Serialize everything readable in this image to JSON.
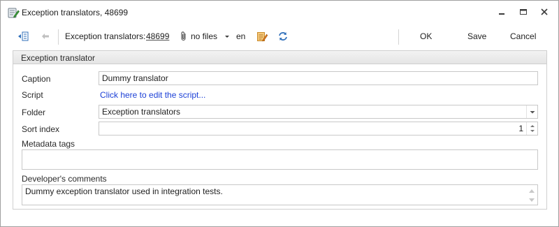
{
  "window": {
    "title": "Exception translators, 48699",
    "icon": "script-edit-icon"
  },
  "toolbar": {
    "entity_label": "Exception translators:",
    "entity_id": "48699",
    "files_label": "no files",
    "language": "en",
    "ok_label": "OK",
    "save_label": "Save",
    "cancel_label": "Cancel"
  },
  "group": {
    "title": "Exception translator"
  },
  "form": {
    "caption_label": "Caption",
    "caption_value": "Dummy translator",
    "script_label": "Script",
    "script_link": "Click here to edit the script...",
    "folder_label": "Folder",
    "folder_value": "Exception translators",
    "sort_label": "Sort index",
    "sort_value": "1",
    "tags_label": "Metadata tags",
    "tags_value": "",
    "comments_label": "Developer's comments",
    "comments_value": "Dummy exception translator used in integration tests."
  },
  "colors": {
    "link": "#1b3fd6",
    "accent_blue": "#2f6fba",
    "icon_orange": "#e8a33a"
  }
}
